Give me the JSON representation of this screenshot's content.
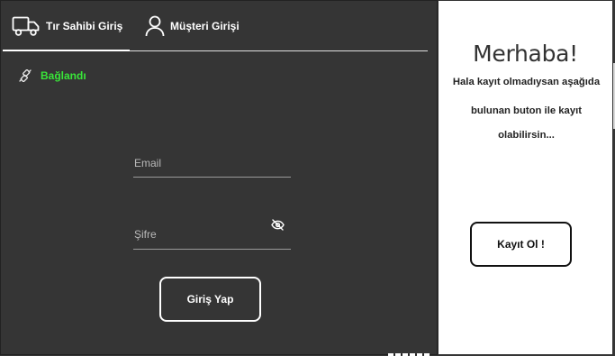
{
  "tabs": {
    "truck_owner_label": "Tır Sahibi Giriş",
    "customer_label": "Müşteri Girişi"
  },
  "status": {
    "text": "Bağlandı",
    "color": "#39e639"
  },
  "form": {
    "email_placeholder": "Email",
    "password_placeholder": "Şifre",
    "login_label": "Giriş Yap"
  },
  "welcome": {
    "title": "Merhaba!",
    "line1": "Hala kayıt olmadıysan aşağıda",
    "line2": "bulunan buton ile kayıt",
    "line3": "olabilirsin...",
    "register_label": "Kayıt Ol !"
  },
  "icons": {
    "truck": "truck-icon",
    "user": "user-icon",
    "connection": "connection-icon",
    "eye": "eye-slash-icon"
  }
}
